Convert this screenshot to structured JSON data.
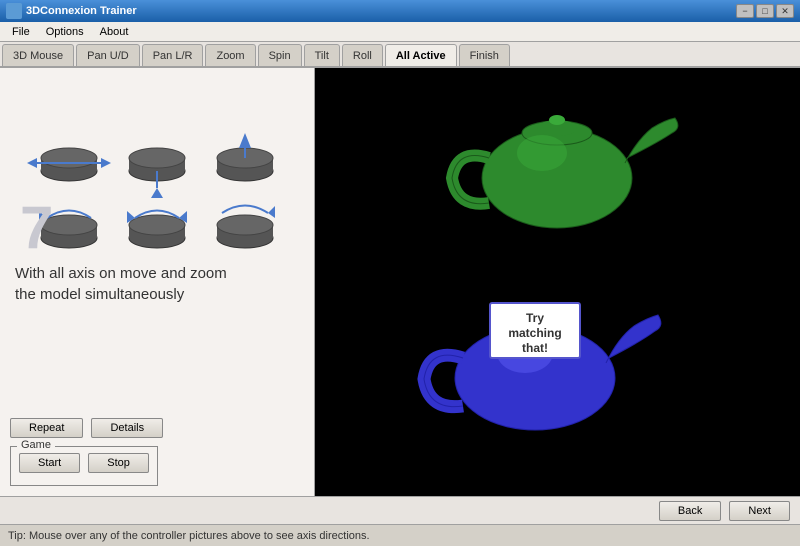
{
  "titleBar": {
    "title": "3DConnexion Trainer",
    "minimizeBtn": "−",
    "maximizeBtn": "□",
    "closeBtn": "✕"
  },
  "menuBar": {
    "items": [
      "File",
      "Options",
      "About"
    ]
  },
  "tabs": [
    {
      "label": "3D Mouse",
      "active": false
    },
    {
      "label": "Pan U/D",
      "active": false
    },
    {
      "label": "Pan L/R",
      "active": false
    },
    {
      "label": "Zoom",
      "active": false
    },
    {
      "label": "Spin",
      "active": false
    },
    {
      "label": "Tilt",
      "active": false
    },
    {
      "label": "Roll",
      "active": false
    },
    {
      "label": "All Active",
      "active": true
    },
    {
      "label": "Finish",
      "active": false
    }
  ],
  "leftPanel": {
    "stepNumber": "7",
    "description": "With all axis on move and zoom\nthe model simultaneously",
    "buttons": {
      "repeat": "Repeat",
      "details": "Details"
    },
    "game": {
      "label": "Game",
      "start": "Start",
      "stop": "Stop"
    }
  },
  "rightPanel": {
    "greenTeapotLabel": "",
    "blueTeapotLabel": "Try\nmatching\nthat!"
  },
  "bottomBar": {
    "backBtn": "Back",
    "nextBtn": "Next"
  },
  "statusBar": {
    "tip": "Tip: Mouse over any of the controller pictures above to see axis directions."
  }
}
